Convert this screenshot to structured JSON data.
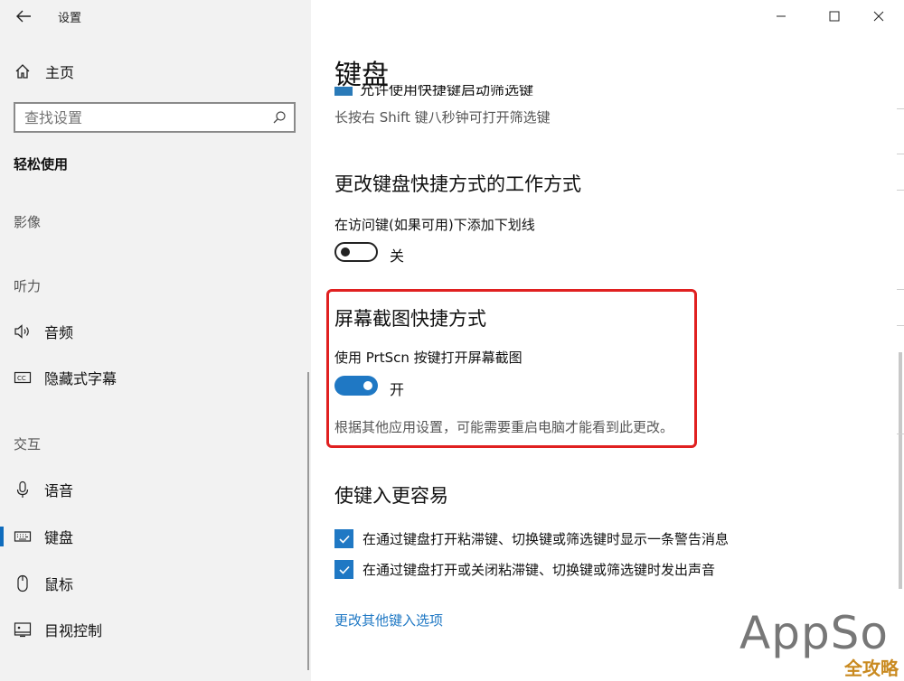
{
  "window": {
    "title": "设置"
  },
  "sidebar": {
    "home_label": "主页",
    "search_placeholder": "查找设置",
    "section_title": "轻松使用",
    "groups": {
      "vision": "影像",
      "hearing": "听力",
      "interaction": "交互"
    },
    "items": [
      {
        "label": "音频",
        "icon": "speaker-icon"
      },
      {
        "label": "隐藏式字幕",
        "icon": "cc-icon"
      },
      {
        "label": "语音",
        "icon": "microphone-icon"
      },
      {
        "label": "键盘",
        "icon": "keyboard-icon",
        "active": true
      },
      {
        "label": "鼠标",
        "icon": "mouse-icon"
      },
      {
        "label": "目视控制",
        "icon": "eye-control-icon"
      }
    ]
  },
  "main": {
    "page_title": "键盘",
    "filter_keys_cut_text": "允许使用快捷键启动筛选键",
    "filter_keys_desc": "长按右 Shift 键八秒钟可打开筛选键",
    "shortcuts_heading": "更改键盘快捷方式的工作方式",
    "underline_label": "在访问键(如果可用)下添加下划线",
    "underline_toggle_state": "关",
    "prtscn_heading": "屏幕截图快捷方式",
    "prtscn_label": "使用 PrtScn 按键打开屏幕截图",
    "prtscn_toggle_state": "开",
    "prtscn_note": "根据其他应用设置，可能需要重启电脑才能看到此更改。",
    "typing_heading": "使键入更容易",
    "checkbox1_label": "在通过键盘打开粘滞键、切换键或筛选键时显示一条警告消息",
    "checkbox2_label": "在通过键盘打开或关闭粘滞键、切换键或筛选键时发出声音",
    "more_link": "更改其他键入选项"
  },
  "watermark": {
    "brand": "AppSo",
    "site": "全攻略"
  },
  "colors": {
    "accent": "#1f78c4",
    "highlight": "#e02020",
    "sidebar_bg": "#f2f2f2"
  }
}
